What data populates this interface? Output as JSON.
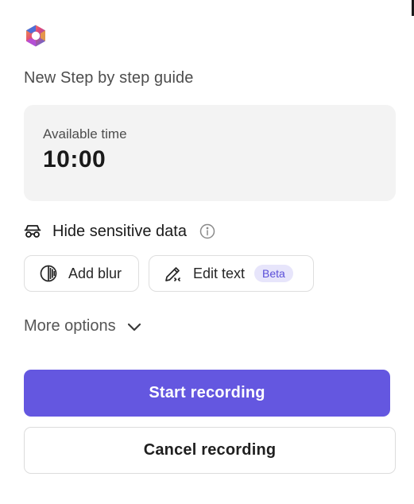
{
  "header": {
    "logo_icon": "app-logo-icon",
    "guide_title": "New Step by step guide"
  },
  "timer": {
    "label": "Available time",
    "value": "10:00"
  },
  "sensitive": {
    "icon": "mask-icon",
    "label": "Hide sensitive data",
    "info_icon": "info-icon"
  },
  "tools": {
    "blur": {
      "icon": "blur-icon",
      "label": "Add blur"
    },
    "edit": {
      "icon": "edit-text-icon",
      "label": "Edit text",
      "badge": "Beta"
    }
  },
  "more_options": {
    "label": "More options",
    "icon": "chevron-down-icon"
  },
  "actions": {
    "start_label": "Start recording",
    "cancel_label": "Cancel recording"
  },
  "colors": {
    "primary": "#6457e0",
    "badge_bg": "#e7e5fb",
    "badge_text": "#5b4fd8",
    "card_bg": "#f3f3f3"
  }
}
